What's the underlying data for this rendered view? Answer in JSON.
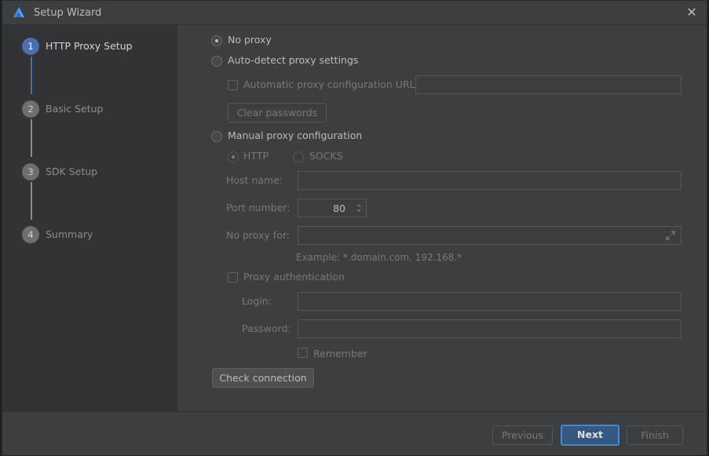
{
  "window": {
    "title": "Setup Wizard",
    "app_icon": "app-logo-icon",
    "close_glyph": "✕"
  },
  "steps": [
    {
      "number": "1",
      "label": "HTTP Proxy Setup",
      "active": true
    },
    {
      "number": "2",
      "label": "Basic Setup",
      "active": false
    },
    {
      "number": "3",
      "label": "SDK Setup",
      "active": false
    },
    {
      "number": "4",
      "label": "Summary",
      "active": false
    }
  ],
  "proxy": {
    "no_proxy_label": "No proxy",
    "auto_detect_label": "Auto-detect proxy settings",
    "auto_config_url_label": "Automatic proxy configuration URL:",
    "auto_config_url_value": "",
    "clear_passwords_label": "Clear passwords",
    "manual_label": "Manual proxy configuration",
    "http_label": "HTTP",
    "socks_label": "SOCKS",
    "host_label": "Host name:",
    "host_value": "",
    "port_label": "Port number:",
    "port_value": "80",
    "no_proxy_for_label": "No proxy for:",
    "no_proxy_for_value": "",
    "example_text": "Example: *.domain.com, 192.168.*",
    "auth_label": "Proxy authentication",
    "login_label": "Login:",
    "login_value": "",
    "password_label": "Password:",
    "password_value": "",
    "remember_label": "Remember",
    "check_connection_label": "Check connection"
  },
  "footer": {
    "previous_label": "Previous",
    "next_label": "Next",
    "finish_label": "Finish"
  },
  "colors": {
    "accent": "#4b6eaf",
    "background": "#3c3f41",
    "sidebar": "#313335"
  }
}
